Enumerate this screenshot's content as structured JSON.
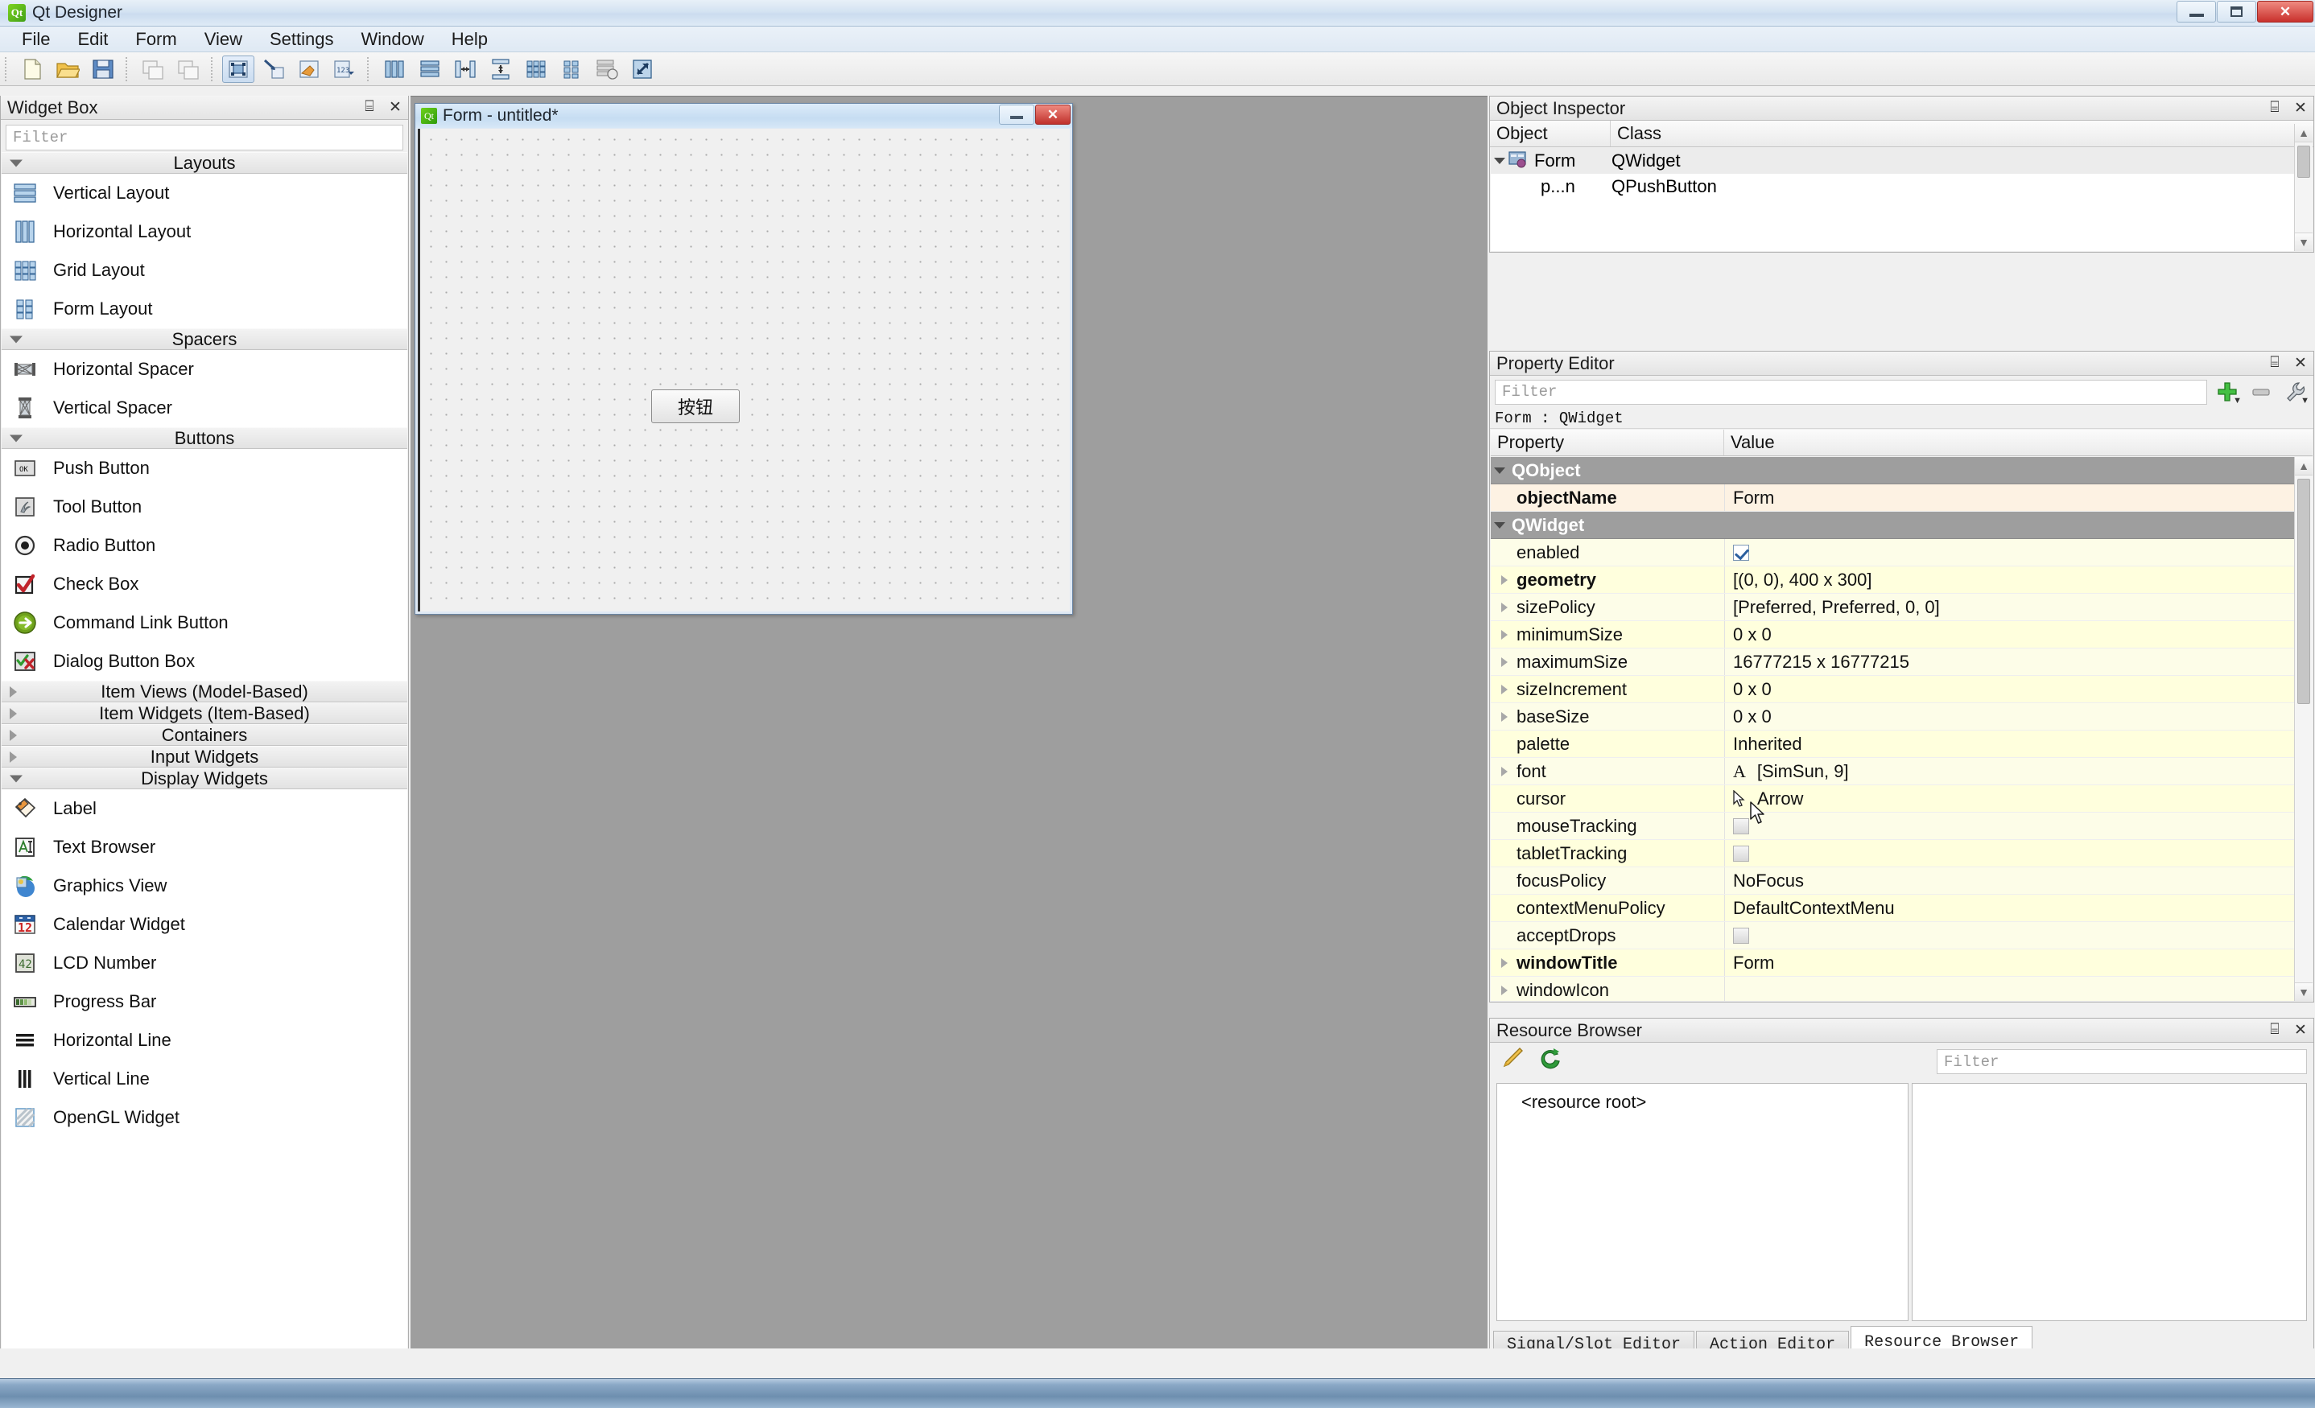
{
  "window": {
    "title": "Qt Designer",
    "icon": "qt-logo-icon",
    "buttons": {
      "minimize": "minimize-icon",
      "maximize": "maximize-icon",
      "close": "close-icon"
    }
  },
  "menubar": {
    "items": [
      {
        "label": "File"
      },
      {
        "label": "Edit"
      },
      {
        "label": "Form"
      },
      {
        "label": "View"
      },
      {
        "label": "Settings"
      },
      {
        "label": "Window"
      },
      {
        "label": "Help"
      }
    ]
  },
  "toolbar": {
    "groups": [
      {
        "buttons": [
          {
            "name": "new-form-button",
            "icon": "new-document-icon"
          },
          {
            "name": "open-form-button",
            "icon": "open-folder-icon"
          },
          {
            "name": "save-form-button",
            "icon": "floppy-save-icon"
          }
        ]
      },
      {
        "buttons": [
          {
            "name": "undo-button",
            "icon": "undo-copy-icon"
          },
          {
            "name": "redo-button",
            "icon": "redo-copy-icon"
          }
        ]
      },
      {
        "buttons": [
          {
            "name": "edit-widgets-button",
            "icon": "edit-widgets-icon",
            "active": true
          },
          {
            "name": "edit-signals-slots-button",
            "icon": "signals-slots-icon"
          },
          {
            "name": "edit-buddies-button",
            "icon": "buddies-icon"
          },
          {
            "name": "edit-tab-order-button",
            "icon": "tab-order-icon"
          }
        ]
      },
      {
        "buttons": [
          {
            "name": "layout-horizontally-button",
            "icon": "layout-horizontal-icon"
          },
          {
            "name": "layout-vertically-button",
            "icon": "layout-vertical-icon"
          },
          {
            "name": "layout-splitter-horizontal-button",
            "icon": "splitter-horizontal-icon"
          },
          {
            "name": "layout-splitter-vertical-button",
            "icon": "splitter-vertical-icon"
          },
          {
            "name": "layout-grid-button",
            "icon": "layout-grid-icon"
          },
          {
            "name": "layout-form-button",
            "icon": "layout-form-icon"
          },
          {
            "name": "break-layout-button",
            "icon": "break-layout-icon"
          },
          {
            "name": "adjust-size-button",
            "icon": "adjust-size-icon"
          }
        ]
      }
    ]
  },
  "widget_box": {
    "title": "Widget Box",
    "filter_placeholder": "Filter",
    "categories": [
      {
        "label": "Layouts",
        "expanded": true,
        "items": [
          {
            "label": "Vertical Layout",
            "icon": "vertical-layout-icon"
          },
          {
            "label": "Horizontal Layout",
            "icon": "horizontal-layout-icon"
          },
          {
            "label": "Grid Layout",
            "icon": "grid-layout-icon"
          },
          {
            "label": "Form Layout",
            "icon": "form-layout-icon"
          }
        ]
      },
      {
        "label": "Spacers",
        "expanded": true,
        "items": [
          {
            "label": "Horizontal Spacer",
            "icon": "horizontal-spacer-icon"
          },
          {
            "label": "Vertical Spacer",
            "icon": "vertical-spacer-icon"
          }
        ]
      },
      {
        "label": "Buttons",
        "expanded": true,
        "items": [
          {
            "label": "Push Button",
            "icon": "push-button-icon"
          },
          {
            "label": "Tool Button",
            "icon": "tool-button-icon"
          },
          {
            "label": "Radio Button",
            "icon": "radio-button-icon"
          },
          {
            "label": "Check Box",
            "icon": "check-box-icon"
          },
          {
            "label": "Command Link Button",
            "icon": "command-link-button-icon"
          },
          {
            "label": "Dialog Button Box",
            "icon": "dialog-button-box-icon"
          }
        ]
      },
      {
        "label": "Item Views (Model-Based)",
        "expanded": false,
        "items": []
      },
      {
        "label": "Item Widgets (Item-Based)",
        "expanded": false,
        "items": []
      },
      {
        "label": "Containers",
        "expanded": false,
        "items": []
      },
      {
        "label": "Input Widgets",
        "expanded": false,
        "items": []
      },
      {
        "label": "Display Widgets",
        "expanded": true,
        "items": [
          {
            "label": "Label",
            "icon": "label-icon"
          },
          {
            "label": "Text Browser",
            "icon": "text-browser-icon"
          },
          {
            "label": "Graphics View",
            "icon": "graphics-view-icon"
          },
          {
            "label": "Calendar Widget",
            "icon": "calendar-widget-icon"
          },
          {
            "label": "LCD Number",
            "icon": "lcd-number-icon"
          },
          {
            "label": "Progress Bar",
            "icon": "progress-bar-icon"
          },
          {
            "label": "Horizontal Line",
            "icon": "horizontal-line-icon"
          },
          {
            "label": "Vertical Line",
            "icon": "vertical-line-icon"
          },
          {
            "label": "OpenGL Widget",
            "icon": "opengl-widget-icon"
          }
        ]
      }
    ]
  },
  "form_window": {
    "title": "Form - untitled*",
    "icon": "qt-logo-icon",
    "minimize": "minimize-icon",
    "close": "close-icon",
    "button_label": "按钮"
  },
  "object_inspector": {
    "title": "Object Inspector",
    "columns": [
      "Object",
      "Class"
    ],
    "rows": [
      {
        "object": "Form",
        "class": "QWidget",
        "icon": "form-widget-icon",
        "selected": true,
        "expanded": true,
        "indent": 0
      },
      {
        "object": "p...n",
        "class": "QPushButton",
        "icon": "",
        "selected": false,
        "expanded": false,
        "indent": 1
      }
    ]
  },
  "property_editor": {
    "title": "Property Editor",
    "filter_placeholder": "Filter",
    "target": "Form : QWidget",
    "columns": [
      "Property",
      "Value"
    ],
    "buttons": [
      {
        "name": "add-dynamic-property-button",
        "icon": "plus-icon"
      },
      {
        "name": "remove-dynamic-property-button",
        "icon": "minus-icon"
      },
      {
        "name": "configure-property-editor-button",
        "icon": "wrench-icon"
      }
    ],
    "rows": [
      {
        "kind": "group",
        "name": "QObject"
      },
      {
        "kind": "prop",
        "name": "objectName",
        "value": "Form",
        "bold": true,
        "expandable": false,
        "shade": "cream"
      },
      {
        "kind": "group",
        "name": "QWidget"
      },
      {
        "kind": "prop",
        "name": "enabled",
        "value": "",
        "control": "checkbox-checked",
        "bold": false,
        "expandable": false,
        "shade": "y2"
      },
      {
        "kind": "prop",
        "name": "geometry",
        "value": "[(0, 0), 400 x 300]",
        "bold": true,
        "expandable": true,
        "shade": "y1"
      },
      {
        "kind": "prop",
        "name": "sizePolicy",
        "value": "[Preferred, Preferred, 0, 0]",
        "bold": false,
        "expandable": true,
        "shade": "y2"
      },
      {
        "kind": "prop",
        "name": "minimumSize",
        "value": "0 x 0",
        "bold": false,
        "expandable": true,
        "shade": "y1"
      },
      {
        "kind": "prop",
        "name": "maximumSize",
        "value": "16777215 x 16777215",
        "bold": false,
        "expandable": true,
        "shade": "y2"
      },
      {
        "kind": "prop",
        "name": "sizeIncrement",
        "value": "0 x 0",
        "bold": false,
        "expandable": true,
        "shade": "y1"
      },
      {
        "kind": "prop",
        "name": "baseSize",
        "value": "0 x 0",
        "bold": false,
        "expandable": true,
        "shade": "y2"
      },
      {
        "kind": "prop",
        "name": "palette",
        "value": "Inherited",
        "bold": false,
        "expandable": false,
        "shade": "y1"
      },
      {
        "kind": "prop",
        "name": "font",
        "value": "[SimSun, 9]",
        "control": "font-icon",
        "bold": false,
        "expandable": true,
        "shade": "y2"
      },
      {
        "kind": "prop",
        "name": "cursor",
        "value": "Arrow",
        "control": "cursor-icon",
        "bold": false,
        "expandable": false,
        "shade": "y1"
      },
      {
        "kind": "prop",
        "name": "mouseTracking",
        "value": "",
        "control": "checkbox-unchecked",
        "bold": false,
        "expandable": false,
        "shade": "y2"
      },
      {
        "kind": "prop",
        "name": "tabletTracking",
        "value": "",
        "control": "checkbox-unchecked",
        "bold": false,
        "expandable": false,
        "shade": "y1"
      },
      {
        "kind": "prop",
        "name": "focusPolicy",
        "value": "NoFocus",
        "bold": false,
        "expandable": false,
        "shade": "y2"
      },
      {
        "kind": "prop",
        "name": "contextMenuPolicy",
        "value": "DefaultContextMenu",
        "bold": false,
        "expandable": false,
        "shade": "y1"
      },
      {
        "kind": "prop",
        "name": "acceptDrops",
        "value": "",
        "control": "checkbox-unchecked",
        "bold": false,
        "expandable": false,
        "shade": "y2"
      },
      {
        "kind": "prop",
        "name": "windowTitle",
        "value": "Form",
        "bold": true,
        "expandable": true,
        "shade": "y1"
      },
      {
        "kind": "prop",
        "name": "windowIcon",
        "value": "",
        "bold": false,
        "expandable": true,
        "shade": "y2"
      }
    ]
  },
  "resource_browser": {
    "title": "Resource Browser",
    "filter_placeholder": "Filter",
    "buttons": [
      {
        "name": "edit-resources-button",
        "icon": "pencil-icon"
      },
      {
        "name": "reload-resources-button",
        "icon": "reload-icon"
      }
    ],
    "root_label": "<resource root>",
    "tabs": [
      {
        "label": "Signal/Slot Editor",
        "selected": false
      },
      {
        "label": "Action Editor",
        "selected": false
      },
      {
        "label": "Resource Browser",
        "selected": true
      }
    ]
  },
  "dock_controls": {
    "float": "float-icon",
    "close": "close-icon"
  },
  "colors": {
    "titlebar": "#cbdcef",
    "dock_header": "#e4e4e4",
    "group_row": "#9e9e9e",
    "prop_yellow": "#ffffdd",
    "prop_cream": "#fdf2e3",
    "mdi_background": "#9e9e9e",
    "accent_green": "#41a017"
  }
}
